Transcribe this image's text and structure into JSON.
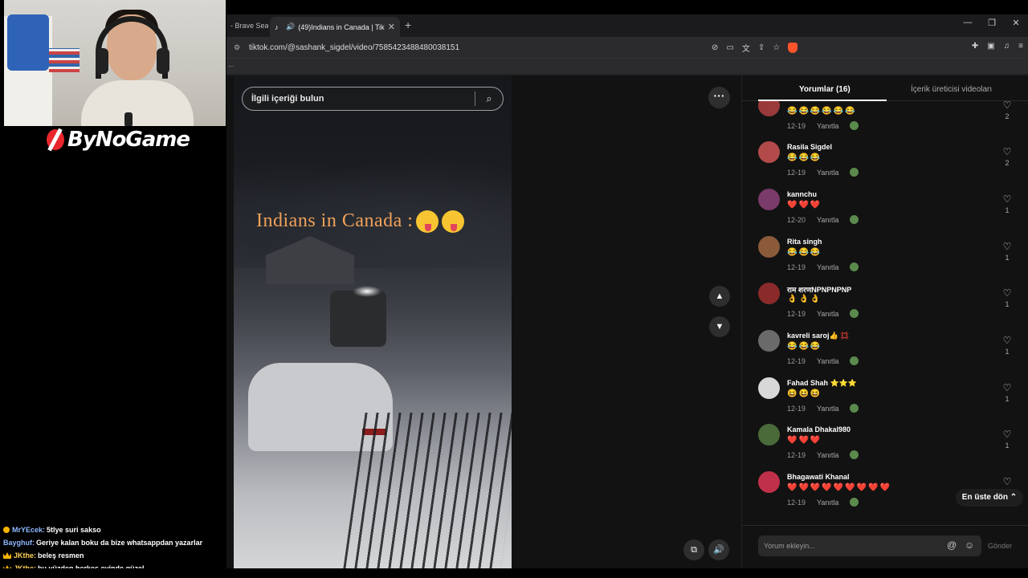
{
  "stream": {
    "logo_text": "ByNoGame",
    "chat": [
      {
        "user": "MrYEcek:",
        "message": "5tlye suri sakso",
        "user_color": "#8fb9ff"
      },
      {
        "user": "Bayghuf:",
        "message": "Geriye kalan boku da bize whatsappdan yazarlar",
        "user_color": "#8fb9ff"
      },
      {
        "user": "JKthe:",
        "message": "beleş resmen",
        "user_color": "#ffd25a"
      },
      {
        "user": "JKthe:",
        "message": "bu yüzden herkes evinde güzel",
        "user_color": "#ffd25a"
      }
    ]
  },
  "browser": {
    "prev_tab": "- Brave Sear",
    "active_tab": "(49)Indians in Canada | TikTok",
    "url": "tiktok.com/@sashank_sigdel/video/7585423488480038151",
    "bookmark_indicator": "..."
  },
  "tiktok": {
    "search_placeholder": "İlgili içeriği bulun",
    "video_caption": "Indians in Canada :",
    "tabs": {
      "comments": "Yorumlar (16)",
      "creator_videos": "İçerik üreticisi videoları"
    },
    "back_to_top": "En üste dön",
    "comment_placeholder": "Yorum ekleyin...",
    "send_label": "Gönder",
    "comments": [
      {
        "name": "",
        "emojis": "😂😂😂😂😂😂",
        "date": "12-19",
        "reply": "Yanıtla",
        "likes": "2",
        "avatar_color": "#9a3a3a"
      },
      {
        "name": "Rasila Sigdel",
        "emojis": "😂😂😂",
        "date": "12-19",
        "reply": "Yanıtla",
        "likes": "2",
        "avatar_color": "#b34a4a"
      },
      {
        "name": "kannchu",
        "emojis": "❤️❤️❤️",
        "date": "12-20",
        "reply": "Yanıtla",
        "likes": "1",
        "avatar_color": "#7a3a6a"
      },
      {
        "name": "Rita singh",
        "emojis": "😂😂😂",
        "date": "12-19",
        "reply": "Yanıtla",
        "likes": "1",
        "avatar_color": "#8a5a3a"
      },
      {
        "name": "राम शरणNPNPNPNP",
        "emojis": "👌👌👌",
        "date": "12-19",
        "reply": "Yanıtla",
        "likes": "1",
        "avatar_color": "#8a2a2a"
      },
      {
        "name": "kavreli saroj👍 💢",
        "emojis": "😂😂😂",
        "date": "12-19",
        "reply": "Yanıtla",
        "likes": "1",
        "avatar_color": "#6a6a6a"
      },
      {
        "name": "Fahad Shah ⭐⭐⭐",
        "emojis": "😆😆😆",
        "date": "12-19",
        "reply": "Yanıtla",
        "likes": "1",
        "avatar_color": "#d8d8d8"
      },
      {
        "name": "Kamala Dhakal980",
        "emojis": "❤️❤️❤️",
        "date": "12-19",
        "reply": "Yanıtla",
        "likes": "1",
        "avatar_color": "#4a6a3a"
      },
      {
        "name": "Bhagawati Khanal",
        "emojis": "❤️❤️❤️❤️❤️❤️❤️❤️❤️",
        "date": "12-19",
        "reply": "Yanıtla",
        "likes": "",
        "avatar_color": "#c0304a"
      }
    ]
  }
}
